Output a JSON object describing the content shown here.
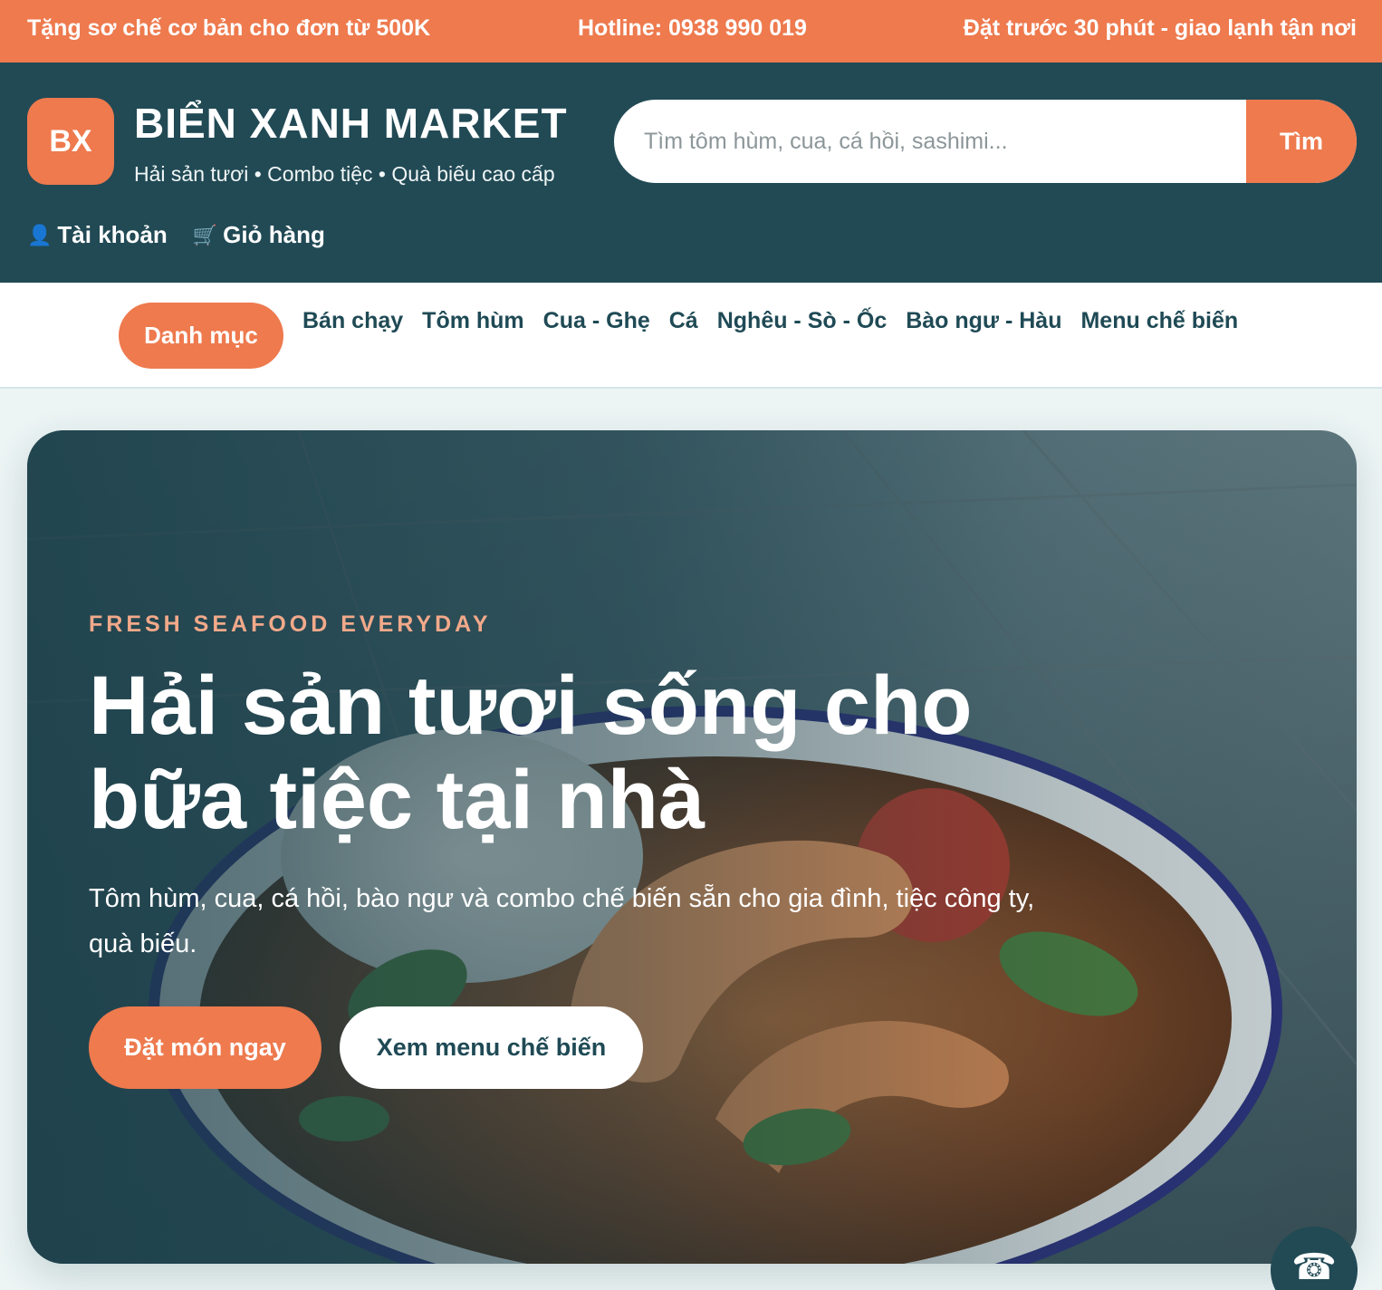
{
  "topbar": {
    "promo": "Tặng sơ chế cơ bản cho đơn từ 500K",
    "hotline": "Hotline: 0938 990 019",
    "delivery": "Đặt trước 30 phút - giao lạnh tận nơi"
  },
  "header": {
    "logo_initials": "BX",
    "brand_name": "BIỂN XANH MARKET",
    "tagline": "Hải sản tươi • Combo tiệc • Quà biếu cao cấp",
    "search": {
      "placeholder": "Tìm tôm hùm, cua, cá hồi, sashimi...",
      "value": "",
      "button_label": "Tìm"
    },
    "links": [
      {
        "icon": "user-icon",
        "glyph": "👤",
        "label": "Tài khoản"
      },
      {
        "icon": "cart-icon",
        "glyph": "🛒",
        "label": "Giỏ hàng"
      }
    ]
  },
  "nav": {
    "category_button": "Danh mục",
    "items": [
      "Bán chạy",
      "Tôm hùm",
      "Cua - Ghẹ",
      "Cá",
      "Nghêu - Sò - Ốc",
      "Bào ngư - Hàu",
      "Menu chế biến"
    ]
  },
  "hero": {
    "eyebrow": "FRESH SEAFOOD EVERYDAY",
    "title": "Hải sản tươi sống cho bữa tiệc tại nhà",
    "description": "Tôm hùm, cua, cá hồi, bào ngư và combo chế biến sẵn cho gia đình, tiệc công ty, quà biếu.",
    "primary_button": "Đặt món ngay",
    "secondary_button": "Xem menu chế biến"
  },
  "floating": {
    "phone_icon": "phone-icon",
    "phone_glyph": "☎"
  },
  "colors": {
    "accent": "#ee7a4e",
    "primary_dark": "#214a55",
    "page_bg": "#ecf4f4"
  }
}
